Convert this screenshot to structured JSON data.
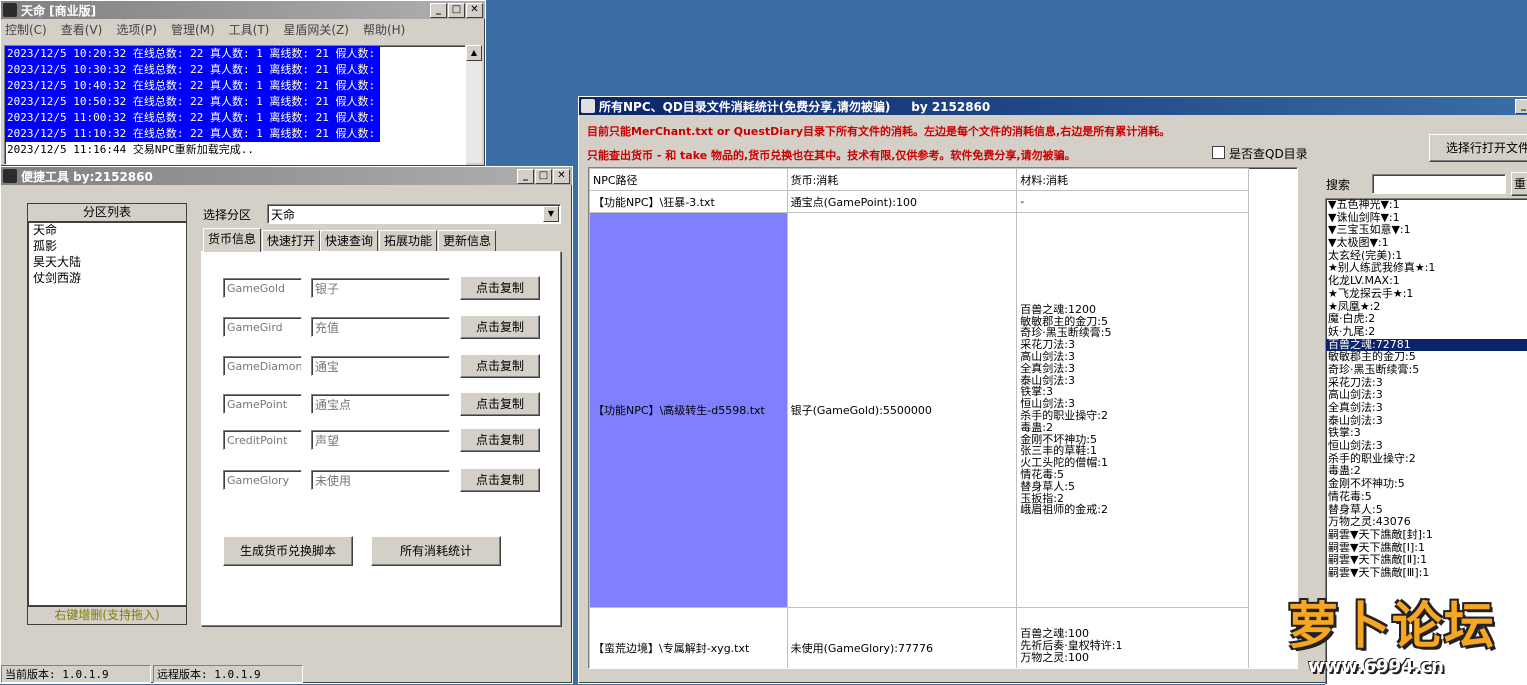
{
  "main_window": {
    "title": "天命 [商业版]",
    "menu": [
      "控制(C)",
      "查看(V)",
      "选项(P)",
      "管理(M)",
      "工具(T)",
      "星盾网关(Z)",
      "帮助(H)"
    ],
    "log": [
      "2023/12/5 10:20:32 在线总数: 22 真人数: 1 离线数: 21 假人数: 0",
      "2023/12/5 10:30:32 在线总数: 22 真人数: 1 离线数: 21 假人数: 0",
      "2023/12/5 10:40:32 在线总数: 22 真人数: 1 离线数: 21 假人数: 0",
      "2023/12/5 10:50:32 在线总数: 22 真人数: 1 离线数: 21 假人数: 0",
      "2023/12/5 11:00:32 在线总数: 22 真人数: 1 离线数: 21 假人数: 0",
      "2023/12/5 11:10:32 在线总数: 22 真人数: 1 离线数: 21 假人数: 0",
      "2023/12/5 11:16:44 交易NPC重新加载完成.."
    ]
  },
  "tool_window": {
    "title": "便捷工具  by:2152860",
    "partition_header": "分区列表",
    "partitions": [
      "天命",
      "孤影",
      "昊天大陆",
      "仗剑西游"
    ],
    "partition_footer": "右键增删(支持拖入)",
    "select_label": "选择分区",
    "selected_partition": "天命",
    "tabs": [
      "货币信息",
      "快速打开",
      "快速查询",
      "拓展功能",
      "更新信息"
    ],
    "currency_rows": [
      {
        "code": "GameGold",
        "name": "银子",
        "button": "点击复制"
      },
      {
        "code": "GameGird",
        "name": "充值",
        "button": "点击复制"
      },
      {
        "code": "GameDiamond",
        "name": "通宝",
        "button": "点击复制"
      },
      {
        "code": "GamePoint",
        "name": "通宝点",
        "button": "点击复制"
      },
      {
        "code": "CreditPoint",
        "name": "声望",
        "button": "点击复制"
      },
      {
        "code": "GameGlory",
        "name": "未使用",
        "button": "点击复制"
      }
    ],
    "gen_button": "生成货币兑换脚本",
    "stats_button": "所有消耗统计",
    "status_local": "当前版本: 1.0.1.9",
    "status_remote": "远程版本: 1.0.1.9"
  },
  "stats_window": {
    "title": "所有NPC、QD目录文件消耗统计(免费分享,请勿被骗)     by 2152860",
    "notice1": "目前只能MerChant.txt or QuestDiary目录下所有文件的消耗。左边是每个文件的消耗信息,右边是所有累计消耗。",
    "notice2": "只能查出货币 - 和 take 物品的,货币兑换也在其中。技术有限,仅供参考。软件免费分享,请勿被骗。",
    "checkbox_label": "是否查QD目录",
    "open_button": "选择行打开文件",
    "search_label": "搜索",
    "search_btn": "重",
    "columns": [
      "NPC路径",
      "货币:消耗",
      "材料:消耗"
    ],
    "rows": [
      {
        "path": "【功能NPC】\\狂暴-3.txt",
        "currency": "通宝点(GamePoint):100",
        "materials": [
          "-"
        ]
      },
      {
        "path": "【功能NPC】\\高级转生-d5598.txt",
        "currency": "银子(GameGold):5500000",
        "materials": [
          "百兽之魂:1200",
          "敏敏郡主的金刀:5",
          "奇珍·黑玉断续膏:5",
          "采花刀法:3",
          "高山剑法:3",
          "全真剑法:3",
          "泰山剑法:3",
          "铁掌:3",
          "恒山剑法:3",
          "杀手的职业操守:2",
          "毒蛊:2",
          "金刚不坏神功:5",
          "张三丰的草鞋:1",
          "火工头陀的僧帽:1",
          "情花毒:5",
          "替身草人:5",
          "玉扳指:2",
          "峨眉祖师的金戒:2"
        ]
      },
      {
        "path": "【蛮荒边境】\\专属解封-xyg.txt",
        "currency": "未使用(GameGlory):77776",
        "materials": [
          "百兽之魂:100",
          "先祈后奏·皇权特许:1",
          "万物之灵:100"
        ]
      }
    ],
    "right_list": [
      "▼五色神光▼:1",
      "▼诛仙剑阵▼:1",
      "▼三宝玉如意▼:1",
      "▼太极图▼:1",
      "太玄经(完美):1",
      "★别人练武我修真★:1",
      "化龙LV.MAX:1",
      "★飞龙探云手★:1",
      "★凤凰★:2",
      "魔·白虎:2",
      "妖·九尾:2",
      "百兽之魂:72781",
      "敏敏郡主的金刀:5",
      "奇珍·黑玉断续膏:5",
      "采花刀法:3",
      "高山剑法:3",
      "全真剑法:3",
      "泰山剑法:3",
      "铁掌:3",
      "恒山剑法:3",
      "杀手的职业操守:2",
      "毒蛊:2",
      "金刚不坏神功:5",
      "情花毒:5",
      "替身草人:5",
      "万物之灵:43076",
      "嗣雲▼天下譙敵[封]:1",
      "嗣雲▼天下譙敵[Ⅰ]:1",
      "嗣雲▼天下譙敵[Ⅱ]:1",
      "嗣雲▼天下譙敵[Ⅲ]:1"
    ]
  },
  "watermark": {
    "text": "萝卜论坛",
    "url": "www.6994.cn"
  },
  "colors": {
    "selection": "#0000ff",
    "highlight_cell": "#8080ff",
    "notice": "#cc0000",
    "desktop": "#3a6ea5"
  }
}
